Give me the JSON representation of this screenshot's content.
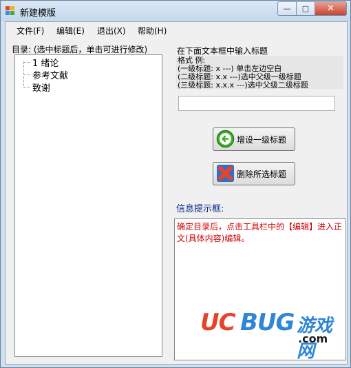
{
  "window": {
    "title": "新建模版",
    "min_glyph": "—",
    "max_glyph": "□",
    "close_glyph": "✕"
  },
  "menu": [
    {
      "label": "文件(F)"
    },
    {
      "label": "编辑(E)"
    },
    {
      "label": "退出(X)"
    },
    {
      "label": "帮助(H)"
    }
  ],
  "left": {
    "label": "目录: (选中标题后，单击可进行修改)",
    "tree": [
      "1 绪论",
      "参考文献",
      "致谢"
    ]
  },
  "right": {
    "instruction": "在下面文本框中输入标题",
    "format_lines": [
      "格式 例:",
      "(一级标题:   x ---) 单击左边空白",
      "(二级标题:   x.x ---)选中父级一级标题",
      "(三级标题:   x.x.x ---)选中父级二级标题"
    ],
    "input_value": "",
    "add_button": "增设一级标题",
    "delete_button": "删除所选标题",
    "info_label": "信息提示框:",
    "info_text": "确定目录后，点击工具栏中的【编辑】进入正文(具体内容)编辑。"
  },
  "watermark": {
    "uc": "UC",
    "bug": "BUG",
    "cn": "游戏网",
    "com": ".com"
  },
  "colors": {
    "info_text": "#d00000",
    "info_label": "#0a2a8a",
    "close_button": "#c8432c"
  }
}
